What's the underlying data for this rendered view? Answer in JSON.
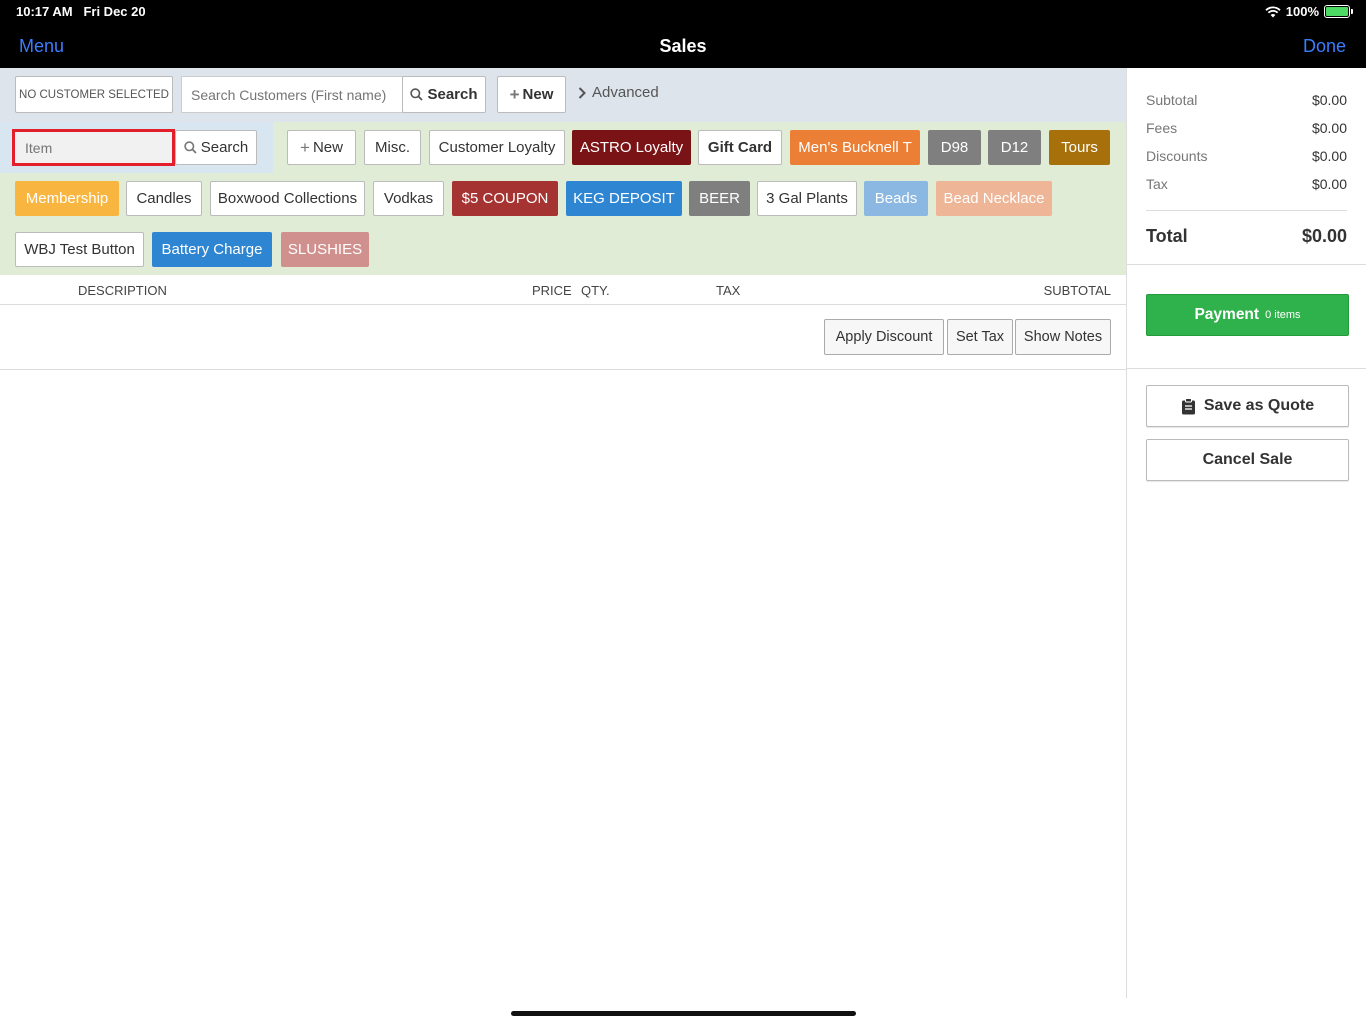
{
  "status": {
    "time": "10:17 AM",
    "date": "Fri Dec 20",
    "battery": "100%"
  },
  "nav": {
    "left": "Menu",
    "title": "Sales",
    "right": "Done"
  },
  "customer": {
    "selected": "NO CUSTOMER SELECTED",
    "search_placeholder": "Search Customers (First name)",
    "search_label": "Search",
    "new_label": "New",
    "advanced_label": "Advanced"
  },
  "item": {
    "placeholder": "Item",
    "search_label": "Search",
    "new_label": "New",
    "misc_label": "Misc."
  },
  "quick_buttons": [
    {
      "label": "Customer Loyalty",
      "color": "#ffffff"
    },
    {
      "label": "ASTRO Loyalty",
      "color": "#7a1316"
    },
    {
      "label": "Gift Card",
      "color": "#ffffff"
    },
    {
      "label": "Men's Bucknell T",
      "color": "#ea7f35"
    },
    {
      "label": "D98",
      "color": "#7f7f7f"
    },
    {
      "label": "D12",
      "color": "#7f7f7f"
    },
    {
      "label": "Tours",
      "color": "#a8700b"
    },
    {
      "label": "Membership",
      "color": "#f8b53f"
    },
    {
      "label": "Candles",
      "color": "#ffffff"
    },
    {
      "label": "Boxwood Collections",
      "color": "#ffffff"
    },
    {
      "label": "Vodkas",
      "color": "#ffffff"
    },
    {
      "label": "$5 COUPON",
      "color": "#a53332"
    },
    {
      "label": "KEG DEPOSIT",
      "color": "#2e85d1"
    },
    {
      "label": "BEER",
      "color": "#7f7f7f"
    },
    {
      "label": "3 Gal Plants",
      "color": "#ffffff"
    },
    {
      "label": "Beads",
      "color": "#8bb8e3"
    },
    {
      "label": "Bead Necklace",
      "color": "#eeb596"
    },
    {
      "label": "WBJ Test Button",
      "color": "#ffffff"
    },
    {
      "label": "Battery Charge",
      "color": "#2e85d1"
    },
    {
      "label": "SLUSHIES",
      "color": "#cf908e"
    }
  ],
  "table": {
    "headers": [
      "DESCRIPTION",
      "PRICE",
      "QTY.",
      "TAX",
      "SUBTOTAL"
    ],
    "actions": [
      "Apply Discount",
      "Set Tax",
      "Show Notes"
    ]
  },
  "summary": {
    "subtotal_label": "Subtotal",
    "subtotal": "$0.00",
    "fees_label": "Fees",
    "fees": "$0.00",
    "discounts_label": "Discounts",
    "discounts": "$0.00",
    "tax_label": "Tax",
    "tax": "$0.00",
    "total_label": "Total",
    "total": "$0.00"
  },
  "payment": {
    "label": "Payment",
    "count": "0 items"
  },
  "quote_label": "Save as Quote",
  "cancel_label": "Cancel Sale"
}
